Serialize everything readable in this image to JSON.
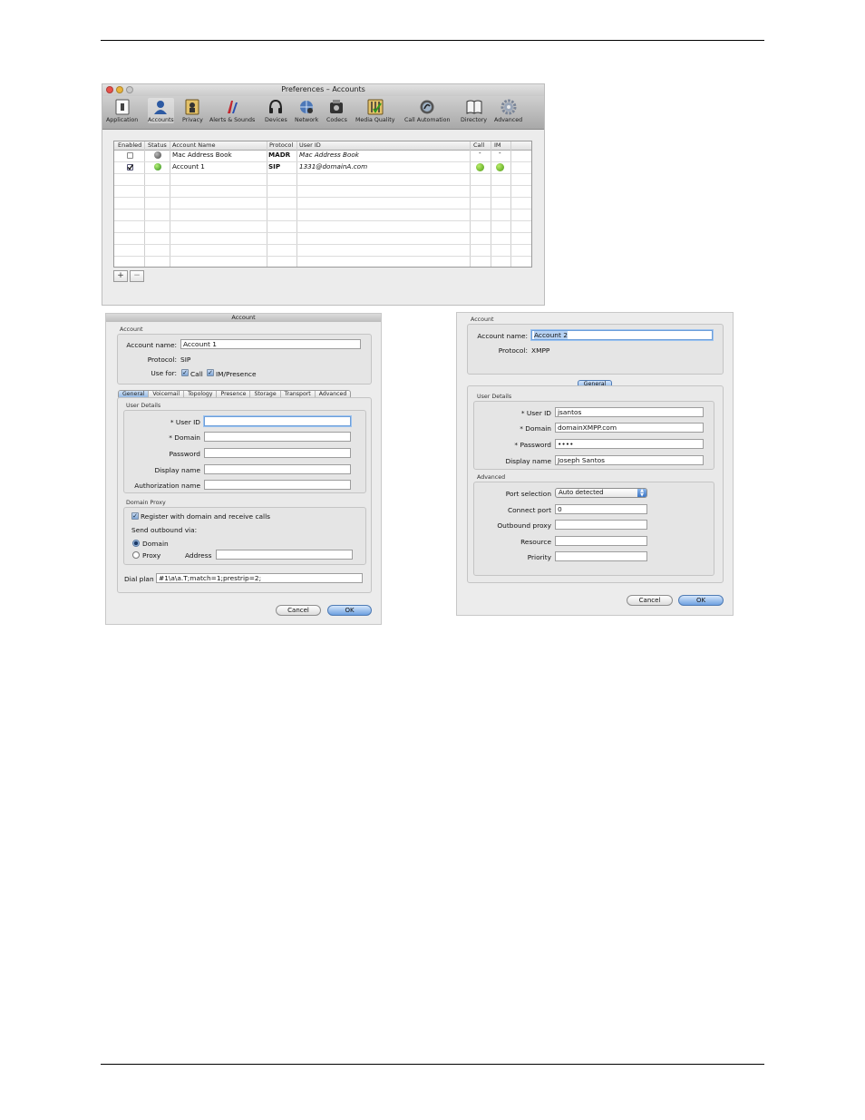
{
  "preferences": {
    "title": "Preferences – Accounts",
    "toolbar": [
      {
        "label": "Application",
        "icon": "application-icon"
      },
      {
        "label": "Accounts",
        "icon": "accounts-icon"
      },
      {
        "label": "Privacy",
        "icon": "privacy-icon"
      },
      {
        "label": "Alerts & Sounds",
        "icon": "alerts-sounds-icon"
      },
      {
        "label": "Devices",
        "icon": "headset-icon"
      },
      {
        "label": "Network",
        "icon": "network-icon"
      },
      {
        "label": "Codecs",
        "icon": "codecs-icon"
      },
      {
        "label": "Media Quality",
        "icon": "media-quality-icon"
      },
      {
        "label": "Call Automation",
        "icon": "call-automation-icon"
      },
      {
        "label": "Directory",
        "icon": "directory-icon"
      },
      {
        "label": "Advanced",
        "icon": "gear-icon"
      }
    ],
    "table": {
      "headers": [
        "Enabled",
        "Status",
        "Account Name",
        "Protocol",
        "User ID",
        "Call",
        "IM"
      ],
      "rows": [
        {
          "enabled": false,
          "status": "gray",
          "name": "Mac Address Book",
          "protocol": "MADR",
          "user_id": "Mac Address Book",
          "call": "-",
          "im": "-"
        },
        {
          "enabled": true,
          "status": "green",
          "name": "Account 1",
          "protocol": "SIP",
          "user_id": "1331@domainA.com",
          "call": "ok",
          "im": "ok"
        }
      ]
    },
    "add_label": "+",
    "remove_label": "−"
  },
  "sip_dialog": {
    "title": "Account",
    "account_group": "Account",
    "account_name_label": "Account name:",
    "account_name": "Account 1",
    "protocol_label": "Protocol:",
    "protocol": "SIP",
    "use_for_label": "Use for:",
    "call_label": "Call",
    "im_label": "IM/Presence",
    "tabs": [
      "General",
      "Voicemail",
      "Topology",
      "Presence",
      "Storage",
      "Transport",
      "Advanced"
    ],
    "user_details_group": "User Details",
    "user_id_label": "* User ID",
    "domain_label": "* Domain",
    "password_label": "Password",
    "display_name_label": "Display name",
    "auth_name_label": "Authorization name",
    "domain_proxy_group": "Domain Proxy",
    "register_label": "Register with domain and receive calls",
    "send_outbound_label": "Send outbound via:",
    "domain_option": "Domain",
    "proxy_option": "Proxy",
    "address_label": "Address",
    "dial_plan_label": "Dial plan",
    "dial_plan": "#1\\a\\a.T;match=1;prestrip=2;",
    "cancel": "Cancel",
    "ok": "OK"
  },
  "xmpp_dialog": {
    "account_group": "Account",
    "account_name_label": "Account name:",
    "account_name": "Account 2",
    "protocol_label": "Protocol:",
    "protocol": "XMPP",
    "general_tab": "General",
    "user_details_group": "User Details",
    "user_id_label": "* User ID",
    "user_id": "jsantos",
    "domain_label": "* Domain",
    "domain": "domainXMPP.com",
    "password_label": "* Password",
    "password": "••••",
    "display_name_label": "Display name",
    "display_name": "Joseph Santos",
    "advanced_group": "Advanced",
    "port_selection_label": "Port selection",
    "port_selection": "Auto detected",
    "connect_port_label": "Connect port",
    "connect_port": "0",
    "outbound_proxy_label": "Outbound proxy",
    "resource_label": "Resource",
    "priority_label": "Priority",
    "cancel": "Cancel",
    "ok": "OK"
  }
}
